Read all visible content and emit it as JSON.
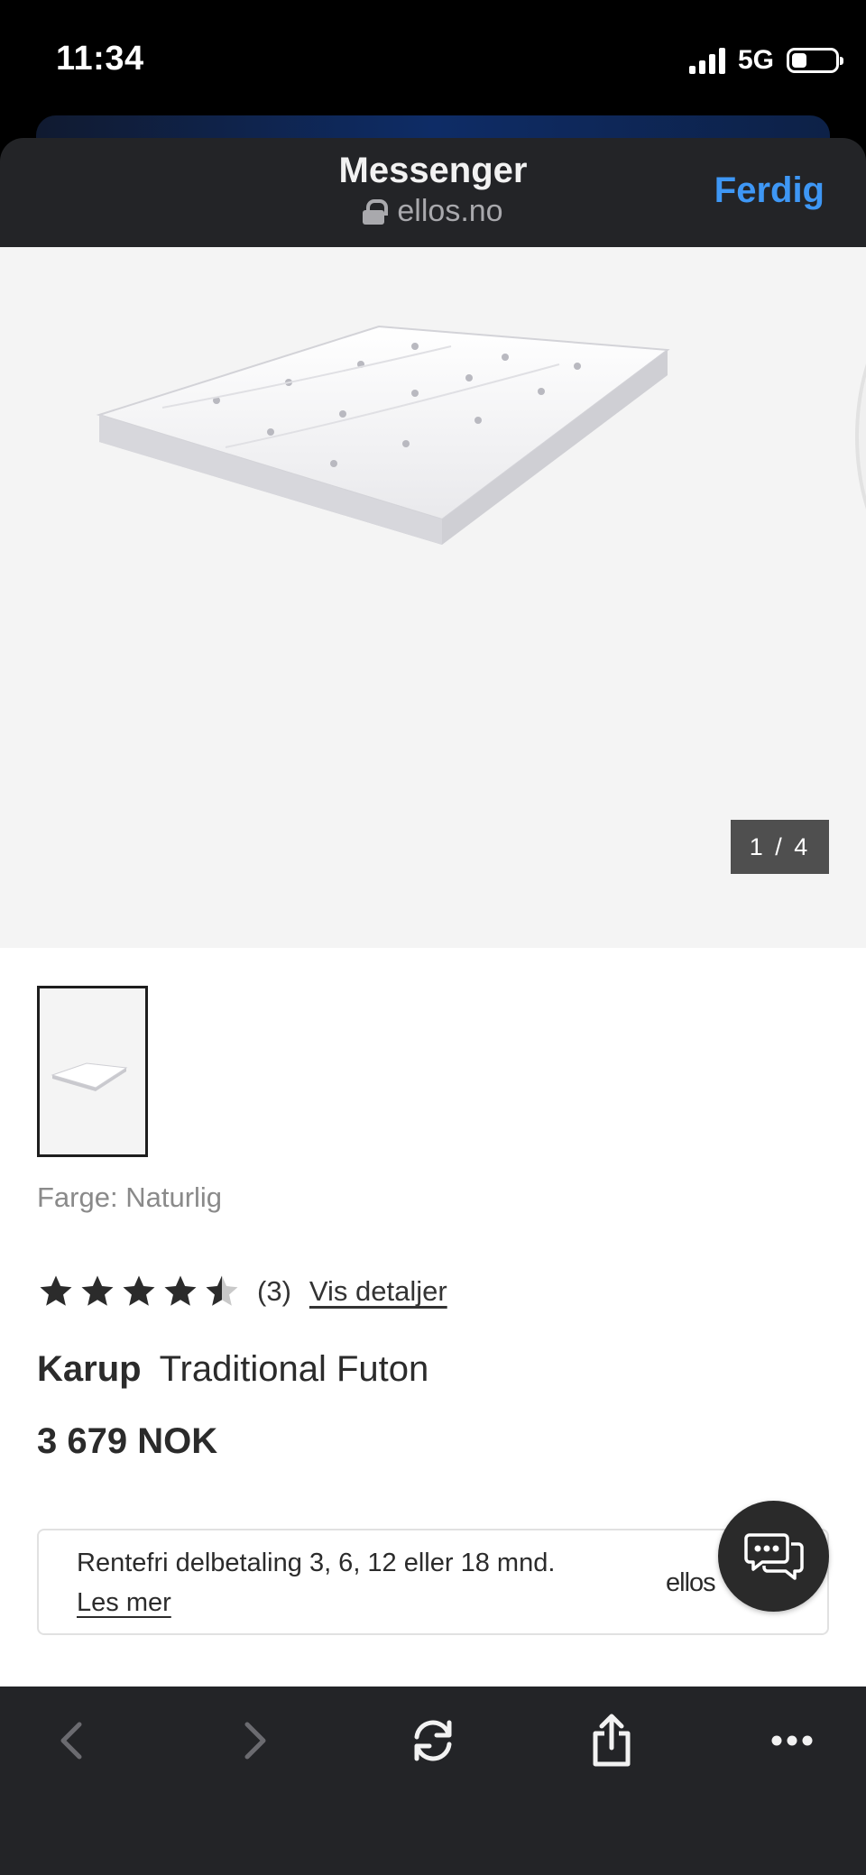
{
  "status_bar": {
    "time": "11:34",
    "network": "5G"
  },
  "browser": {
    "title": "Messenger",
    "url": "ellos.no",
    "done_label": "Ferdig"
  },
  "gallery": {
    "counter": "1 / 4"
  },
  "product": {
    "color_line": "Farge: Naturlig",
    "rating": 4.5,
    "rating_max": 5,
    "review_count": "(3)",
    "details_link": "Vis detaljer",
    "brand": "Karup",
    "name": "Traditional Futon",
    "price": "3 679 NOK"
  },
  "financing": {
    "text": "Rentefri delbetaling 3, 6, 12 eller 18 mnd.",
    "link": "Les mer",
    "logo": "ellos"
  },
  "icons": {
    "chat": "chat-bubbles-icon",
    "back": "chevron-left-icon",
    "forward": "chevron-right-icon",
    "reload": "reload-icon",
    "share": "share-icon",
    "more": "more-dots-icon"
  },
  "colors": {
    "accent": "#3e97f5",
    "header_bg": "#232427",
    "hero_bg": "#f4f4f4",
    "text": "#2b2b2b"
  }
}
